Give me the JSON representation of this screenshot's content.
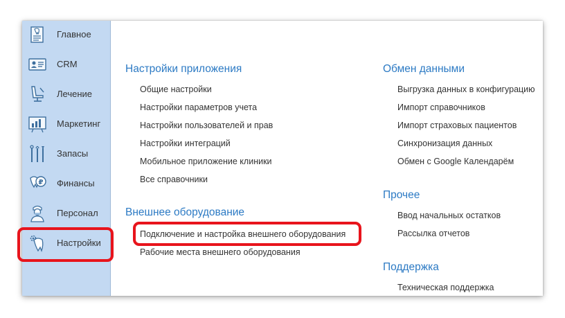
{
  "sidebar": {
    "items": [
      {
        "label": "Главное",
        "icon": "tooth-list-icon"
      },
      {
        "label": "CRM",
        "icon": "contact-card-icon"
      },
      {
        "label": "Лечение",
        "icon": "dental-chair-icon"
      },
      {
        "label": "Маркетинг",
        "icon": "chart-board-icon"
      },
      {
        "label": "Запасы",
        "icon": "dental-tools-icon"
      },
      {
        "label": "Финансы",
        "icon": "tooth-ruble-icon"
      },
      {
        "label": "Персонал",
        "icon": "doctor-icon"
      },
      {
        "label": "Настройки",
        "icon": "tooth-gear-icon"
      }
    ],
    "active": "Настройки"
  },
  "sections": {
    "app_settings": {
      "title": "Настройки приложения",
      "links": [
        "Общие настройки",
        "Настройки параметров учета",
        "Настройки пользователей и прав",
        "Настройки интеграций",
        "Мобильное приложение клиники",
        "Все справочники"
      ]
    },
    "hardware": {
      "title": "Внешнее оборудование",
      "links": [
        "Подключение и настройка внешнего оборудования",
        "Рабочие места внешнего оборудования"
      ]
    },
    "data_exchange": {
      "title": "Обмен данными",
      "links": [
        "Выгрузка данных в конфигурацию",
        "Импорт справочников",
        "Импорт страховых пациентов",
        "Синхронизация данных",
        "Обмен с Google Календарём"
      ]
    },
    "other": {
      "title": "Прочее",
      "links": [
        "Ввод начальных остатков",
        "Рассылка отчетов"
      ]
    },
    "support": {
      "title": "Поддержка",
      "links": [
        "Техническая поддержка"
      ]
    }
  },
  "colors": {
    "sidebar_bg": "#c3d9f2",
    "section_title": "#2c7ac4",
    "highlight": "#e8141c",
    "link_text": "#333333"
  }
}
